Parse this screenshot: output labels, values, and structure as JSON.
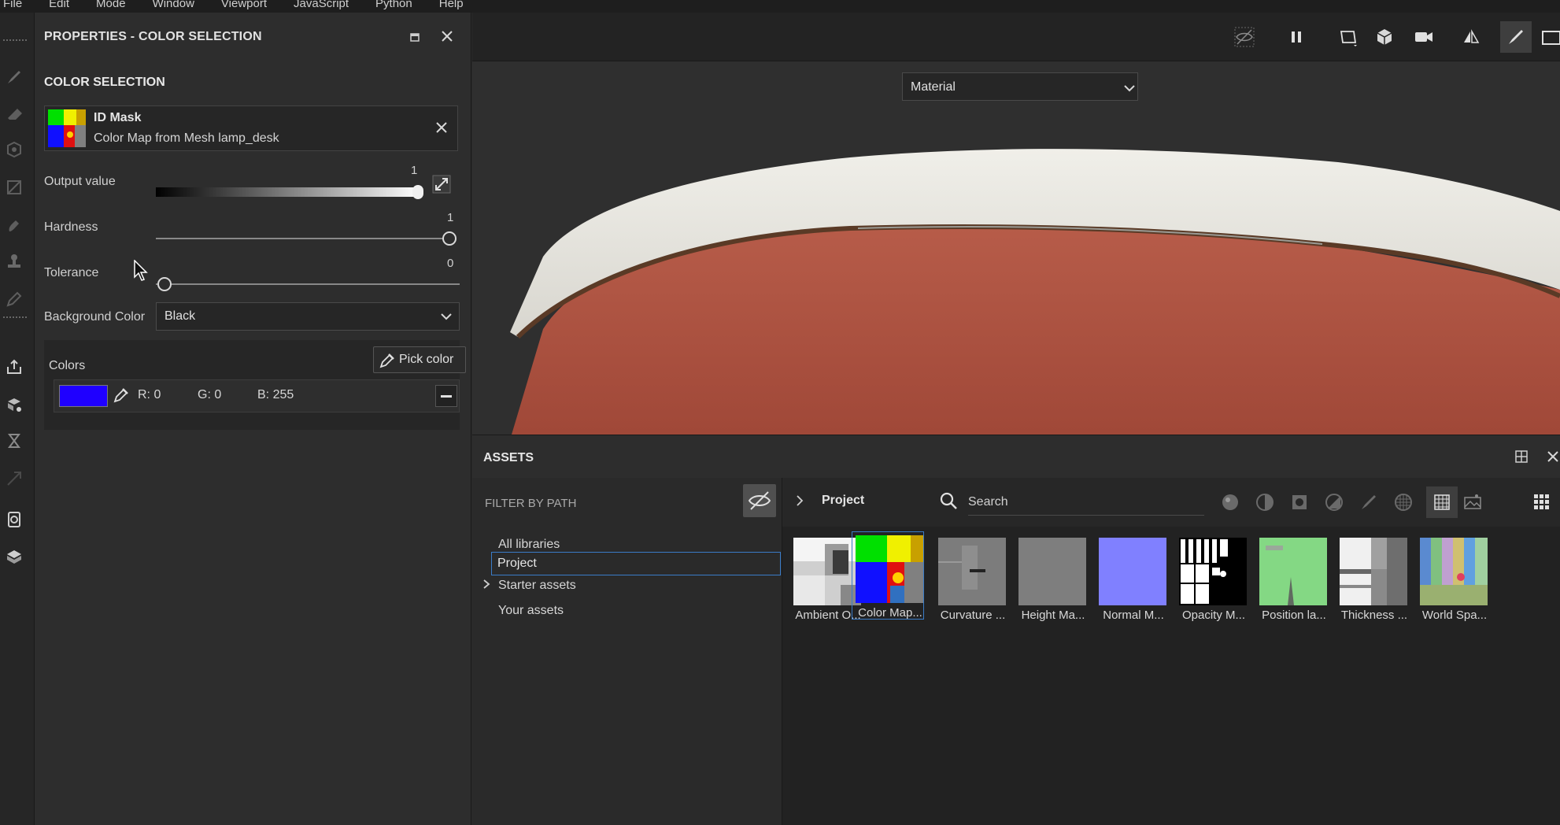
{
  "menu": [
    "File",
    "Edit",
    "Mode",
    "Window",
    "Viewport",
    "JavaScript",
    "Python",
    "Help"
  ],
  "properties": {
    "title": "PROPERTIES - COLOR SELECTION",
    "section": "COLOR SELECTION",
    "id_mask": {
      "name": "ID Mask",
      "description": "Color Map from Mesh lamp_desk"
    },
    "output_value": {
      "label": "Output value",
      "value": "1",
      "fraction": 1.0
    },
    "hardness": {
      "label": "Hardness",
      "value": "1",
      "fraction": 1.0
    },
    "tolerance": {
      "label": "Tolerance",
      "value": "0",
      "fraction": 0.0
    },
    "background_color": {
      "label": "Background Color",
      "value": "Black"
    },
    "colors": {
      "label": "Colors",
      "pick_button": "Pick color",
      "entries": [
        {
          "r": "R: 0",
          "g": "G: 0",
          "b": "B: 255",
          "hex": "#0000ff"
        }
      ]
    }
  },
  "viewport": {
    "mode_select": "Material"
  },
  "assets": {
    "title": "ASSETS",
    "filter_label": "FILTER BY PATH",
    "tree": [
      "All libraries",
      "Project",
      "Starter assets",
      "Your assets"
    ],
    "selected_tree": "Project",
    "breadcrumb": "Project",
    "search_placeholder": "Search",
    "items": [
      {
        "name": "Ambient O...",
        "kind": "ao"
      },
      {
        "name": "Color Map...",
        "kind": "color",
        "selected": true
      },
      {
        "name": "Curvature ...",
        "kind": "curv"
      },
      {
        "name": "Height Ma...",
        "kind": "height"
      },
      {
        "name": "Normal M...",
        "kind": "normal"
      },
      {
        "name": "Opacity M...",
        "kind": "opacity"
      },
      {
        "name": "Position la...",
        "kind": "position"
      },
      {
        "name": "Thickness ...",
        "kind": "thickness"
      },
      {
        "name": "World Spa...",
        "kind": "world"
      }
    ]
  },
  "colors": {
    "accent": "#3a7cc8",
    "swatch": "#1f00ff"
  }
}
